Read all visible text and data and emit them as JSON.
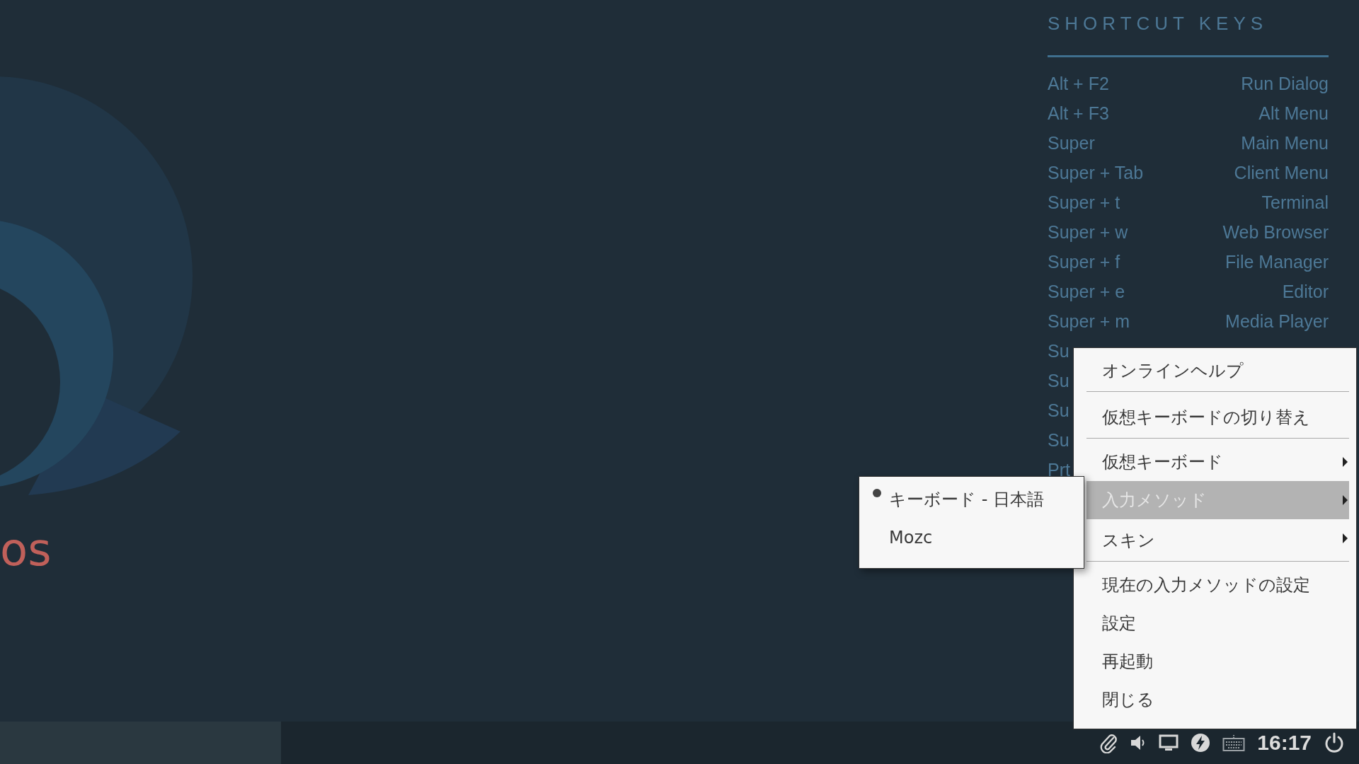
{
  "desktop": {
    "wordmark": "os"
  },
  "shortcuts": {
    "title": "SHORTCUT KEYS",
    "rows": [
      {
        "key": "Alt + F2",
        "action": "Run Dialog"
      },
      {
        "key": "Alt + F3",
        "action": "Alt Menu"
      },
      {
        "key": "Super",
        "action": "Main Menu"
      },
      {
        "key": "Super + Tab",
        "action": "Client Menu"
      },
      {
        "key": "Super + t",
        "action": "Terminal"
      },
      {
        "key": "Super + w",
        "action": "Web Browser"
      },
      {
        "key": "Super + f",
        "action": "File Manager"
      },
      {
        "key": "Super + e",
        "action": "Editor"
      },
      {
        "key": "Super + m",
        "action": "Media Player"
      },
      {
        "key": "Su"
      },
      {
        "key": "Su"
      },
      {
        "key": "Su"
      },
      {
        "key": "Su"
      },
      {
        "key": "Prt"
      }
    ]
  },
  "context_menu": {
    "items": [
      {
        "label": "オンラインヘルプ",
        "submenu": false,
        "selected": false,
        "separator_after": true
      },
      {
        "label": "仮想キーボードの切り替え",
        "submenu": false,
        "selected": false,
        "separator_after": true
      },
      {
        "label": "仮想キーボード",
        "submenu": true,
        "selected": false,
        "separator_after": false
      },
      {
        "label": "入力メソッド",
        "submenu": true,
        "selected": true,
        "separator_after": false
      },
      {
        "label": "スキン",
        "submenu": true,
        "selected": false,
        "separator_after": true
      },
      {
        "label": "現在の入力メソッドの設定",
        "submenu": false,
        "selected": false,
        "separator_after": false
      },
      {
        "label": "設定",
        "submenu": false,
        "selected": false,
        "separator_after": false
      },
      {
        "label": "再起動",
        "submenu": false,
        "selected": false,
        "separator_after": false
      },
      {
        "label": "閉じる",
        "submenu": false,
        "selected": false,
        "separator_after": false
      }
    ]
  },
  "submenu": {
    "items": [
      {
        "label": "キーボード - 日本語",
        "selected": true
      },
      {
        "label": "Mozc",
        "selected": false
      }
    ]
  },
  "taskbar": {
    "clock": "16:17"
  }
}
